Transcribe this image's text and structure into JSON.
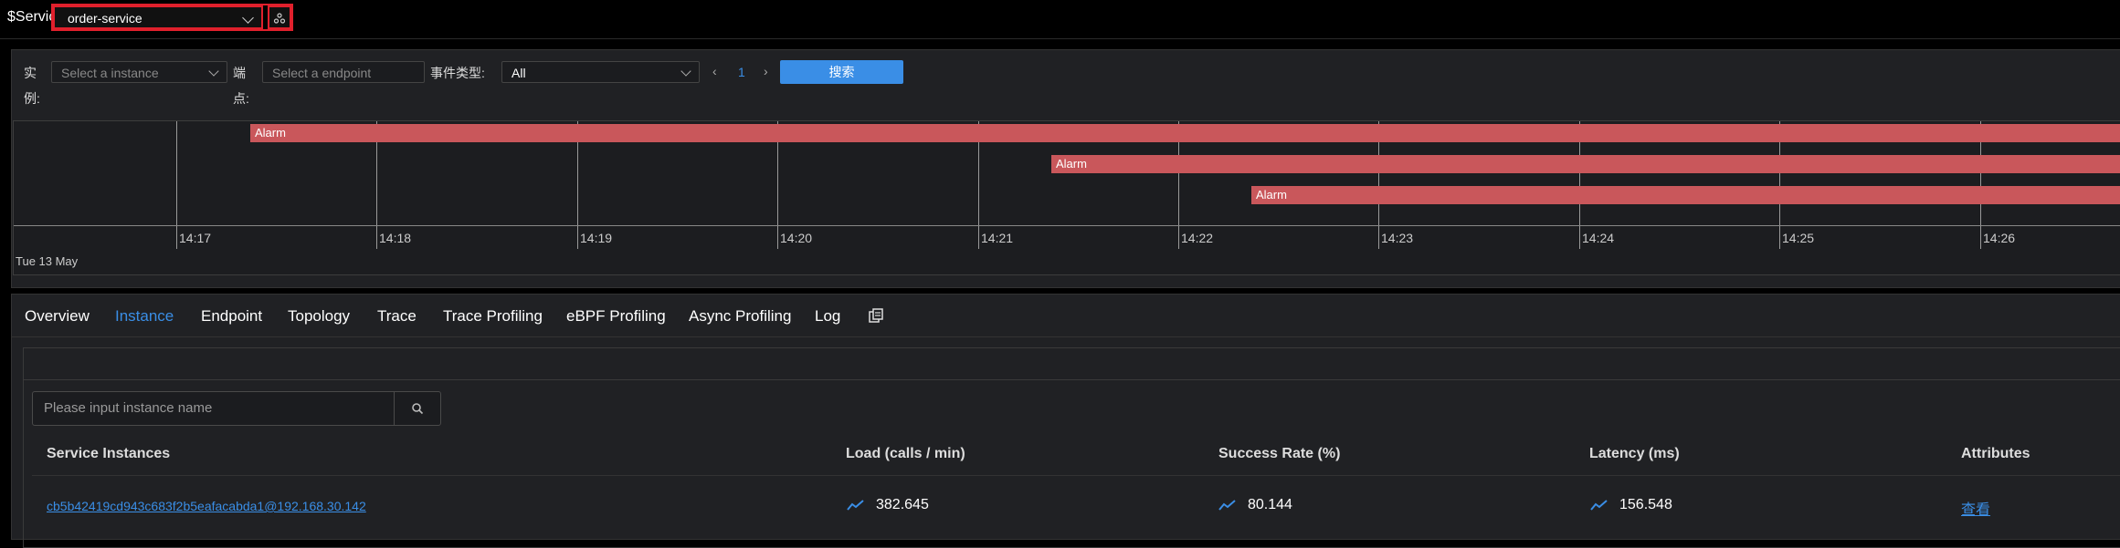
{
  "topbar": {
    "service_label": "$Service:",
    "service_value": "order-service"
  },
  "filters": {
    "instance_label_1": "实",
    "instance_label_2": "例:",
    "instance_placeholder": "Select a instance",
    "endpoint_label_1": "端",
    "endpoint_label_2": "点:",
    "endpoint_placeholder": "Select a endpoint",
    "event_type_label": "事件类型:",
    "event_type_value": "All",
    "page": "1",
    "search_label": "搜索"
  },
  "timeline": {
    "ticks": [
      "14:17",
      "14:18",
      "14:19",
      "14:20",
      "14:21",
      "14:22",
      "14:23",
      "14:24",
      "14:25",
      "14:26"
    ],
    "date": "Tue 13 May",
    "events": [
      {
        "label": "Alarm"
      },
      {
        "label": "Alarm"
      },
      {
        "label": "Alarm"
      }
    ],
    "alarm_color": "#c9575b"
  },
  "tabs": [
    "Overview",
    "Instance",
    "Endpoint",
    "Topology",
    "Trace",
    "Trace Profiling",
    "eBPF Profiling",
    "Async Profiling",
    "Log"
  ],
  "active_tab": "Instance",
  "instances": {
    "search_placeholder": "Please input instance name",
    "columns": [
      "Service Instances",
      "Load (calls / min)",
      "Success Rate (%)",
      "Latency (ms)",
      "Attributes"
    ],
    "rows": [
      {
        "name": "cb5b42419cd943c683f2b5eafacabda1@192.168.30.142",
        "load": "382.645",
        "success_rate": "80.144",
        "latency": "156.548",
        "attributes": "查看"
      }
    ]
  },
  "colors": {
    "accent": "#3a8ee6",
    "highlight_border": "#e0202c",
    "background": "#202124"
  }
}
